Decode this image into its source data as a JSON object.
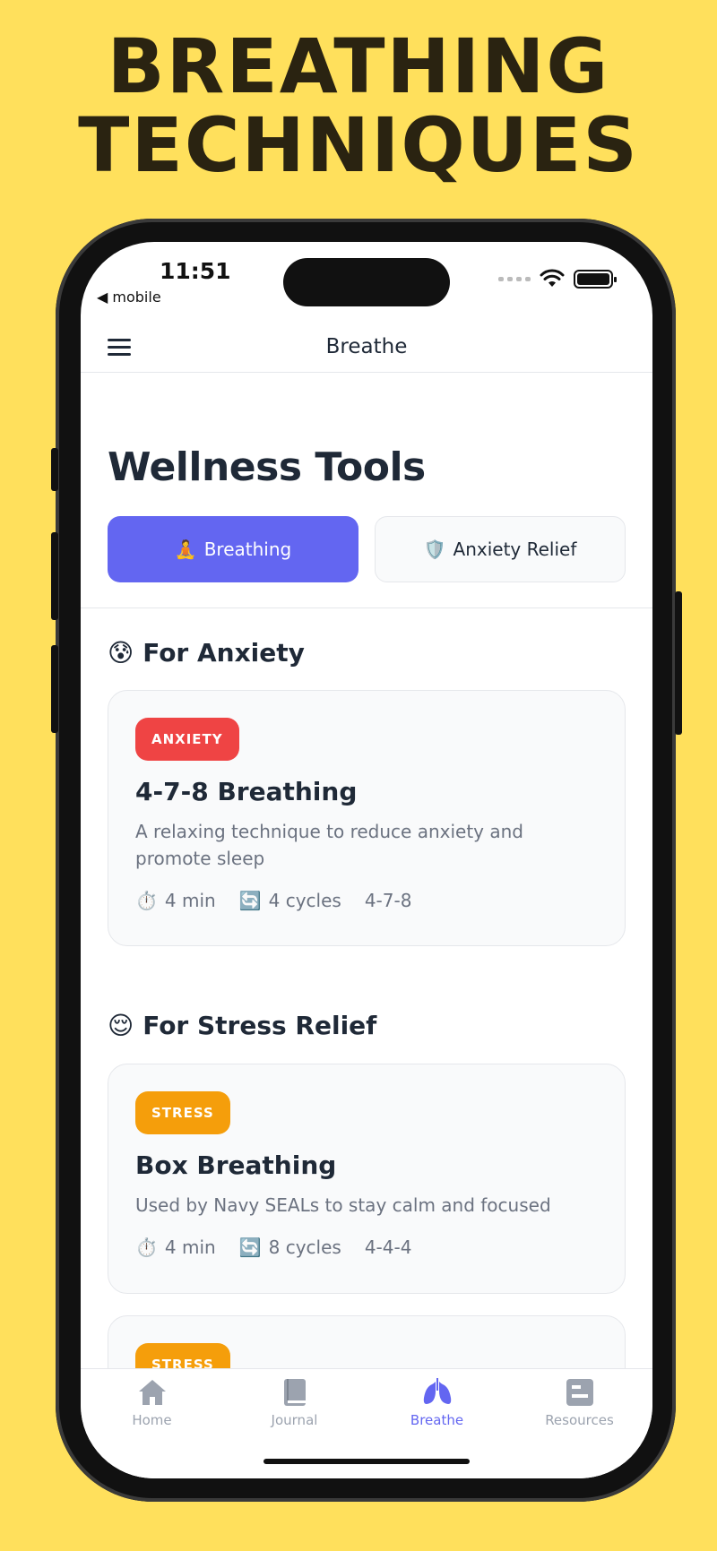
{
  "headline": {
    "line1": "BREATHING",
    "line2": "TECHNIQUES"
  },
  "status_bar": {
    "time": "11:51",
    "back_label": "◀ mobile"
  },
  "navbar": {
    "title": "Breathe"
  },
  "page": {
    "title": "Wellness Tools"
  },
  "segments": [
    {
      "icon": "🧘",
      "label": "Breathing",
      "active": true
    },
    {
      "icon": "🛡️",
      "label": "Anxiety Relief",
      "active": false
    }
  ],
  "groups": [
    {
      "emoji": "😰",
      "title": "For Anxiety",
      "cards": [
        {
          "badge": "ANXIETY",
          "badge_color": "#EF4444",
          "title": "4-7-8 Breathing",
          "description": "A relaxing technique to reduce anxiety and promote sleep",
          "duration": "4 min",
          "cycles": "4 cycles",
          "pattern": "4-7-8"
        }
      ]
    },
    {
      "emoji": "😌",
      "title": "For Stress Relief",
      "cards": [
        {
          "badge": "STRESS",
          "badge_color": "#F59E0B",
          "title": "Box Breathing",
          "description": "Used by Navy SEALs to stay calm and focused",
          "duration": "4 min",
          "cycles": "8 cycles",
          "pattern": "4-4-4"
        },
        {
          "badge": "STRESS",
          "badge_color": "#F59E0B"
        }
      ]
    }
  ],
  "meta_icons": {
    "timer": "⏱️",
    "cycles": "🔄"
  },
  "tabbar": [
    {
      "icon": "home-icon",
      "label": "Home",
      "active": false
    },
    {
      "icon": "book-icon",
      "label": "Journal",
      "active": false
    },
    {
      "icon": "lungs-icon",
      "label": "Breathe",
      "active": true
    },
    {
      "icon": "resources-icon",
      "label": "Resources",
      "active": false
    }
  ],
  "colors": {
    "background": "#FFE05C",
    "accent": "#6366F1",
    "anxiety": "#EF4444",
    "stress": "#F59E0B"
  }
}
